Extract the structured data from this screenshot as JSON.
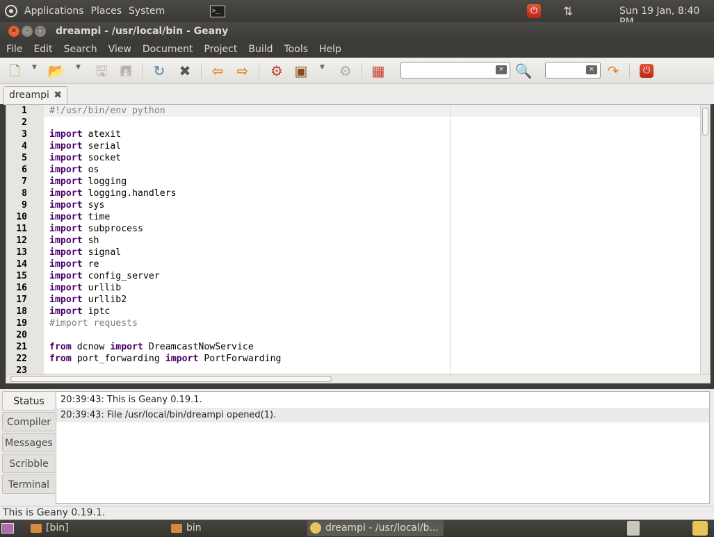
{
  "top_panel": {
    "menus": [
      "Applications",
      "Places",
      "System"
    ],
    "clock": "Sun 19 Jan,  8:40 PM"
  },
  "window": {
    "title": "dreampi - /usr/local/bin - Geany"
  },
  "menu_bar": [
    "File",
    "Edit",
    "Search",
    "View",
    "Document",
    "Project",
    "Build",
    "Tools",
    "Help"
  ],
  "tab": {
    "label": "dreampi"
  },
  "editor": {
    "lines": [
      {
        "n": "1",
        "parts": [
          {
            "t": "#!/usr/bin/env python",
            "c": "cm"
          }
        ]
      },
      {
        "n": "2",
        "parts": []
      },
      {
        "n": "3",
        "parts": [
          {
            "t": "import",
            "c": "kw"
          },
          {
            "t": " atexit",
            "c": ""
          }
        ]
      },
      {
        "n": "4",
        "parts": [
          {
            "t": "import",
            "c": "kw"
          },
          {
            "t": " serial",
            "c": ""
          }
        ]
      },
      {
        "n": "5",
        "parts": [
          {
            "t": "import",
            "c": "kw"
          },
          {
            "t": " socket",
            "c": ""
          }
        ]
      },
      {
        "n": "6",
        "parts": [
          {
            "t": "import",
            "c": "kw"
          },
          {
            "t": " os",
            "c": ""
          }
        ]
      },
      {
        "n": "7",
        "parts": [
          {
            "t": "import",
            "c": "kw"
          },
          {
            "t": " logging",
            "c": ""
          }
        ]
      },
      {
        "n": "8",
        "parts": [
          {
            "t": "import",
            "c": "kw"
          },
          {
            "t": " logging.handlers",
            "c": ""
          }
        ]
      },
      {
        "n": "9",
        "parts": [
          {
            "t": "import",
            "c": "kw"
          },
          {
            "t": " sys",
            "c": ""
          }
        ]
      },
      {
        "n": "10",
        "parts": [
          {
            "t": "import",
            "c": "kw"
          },
          {
            "t": " time",
            "c": ""
          }
        ]
      },
      {
        "n": "11",
        "parts": [
          {
            "t": "import",
            "c": "kw"
          },
          {
            "t": " subprocess",
            "c": ""
          }
        ]
      },
      {
        "n": "12",
        "parts": [
          {
            "t": "import",
            "c": "kw"
          },
          {
            "t": " sh",
            "c": ""
          }
        ]
      },
      {
        "n": "13",
        "parts": [
          {
            "t": "import",
            "c": "kw"
          },
          {
            "t": " signal",
            "c": ""
          }
        ]
      },
      {
        "n": "14",
        "parts": [
          {
            "t": "import",
            "c": "kw"
          },
          {
            "t": " re",
            "c": ""
          }
        ]
      },
      {
        "n": "15",
        "parts": [
          {
            "t": "import",
            "c": "kw"
          },
          {
            "t": " config_server",
            "c": ""
          }
        ]
      },
      {
        "n": "16",
        "parts": [
          {
            "t": "import",
            "c": "kw"
          },
          {
            "t": " urllib",
            "c": ""
          }
        ]
      },
      {
        "n": "17",
        "parts": [
          {
            "t": "import",
            "c": "kw"
          },
          {
            "t": " urllib2",
            "c": ""
          }
        ]
      },
      {
        "n": "18",
        "parts": [
          {
            "t": "import",
            "c": "kw"
          },
          {
            "t": " iptc",
            "c": ""
          }
        ]
      },
      {
        "n": "19",
        "parts": [
          {
            "t": "#import requests",
            "c": "cm"
          }
        ]
      },
      {
        "n": "20",
        "parts": []
      },
      {
        "n": "21",
        "parts": [
          {
            "t": "from",
            "c": "kw"
          },
          {
            "t": " dcnow ",
            "c": ""
          },
          {
            "t": "import",
            "c": "kw"
          },
          {
            "t": " DreamcastNowService",
            "c": ""
          }
        ]
      },
      {
        "n": "22",
        "parts": [
          {
            "t": "from",
            "c": "kw"
          },
          {
            "t": " port_forwarding ",
            "c": ""
          },
          {
            "t": "import",
            "c": "kw"
          },
          {
            "t": " PortForwarding",
            "c": ""
          }
        ]
      },
      {
        "n": "23",
        "parts": []
      }
    ]
  },
  "message_window": {
    "tabs": [
      "Status",
      "Compiler",
      "Messages",
      "Scribble",
      "Terminal"
    ],
    "active_tab": "Status",
    "lines": [
      "20:39:43: This is Geany 0.19.1.",
      "20:39:43: File /usr/local/bin/dreampi opened(1)."
    ]
  },
  "statusbar": {
    "text": "This is Geany 0.19.1."
  },
  "taskbar": {
    "items": [
      {
        "label": "[bin]",
        "icon": "folder-icon",
        "active": false
      },
      {
        "label": "bin",
        "icon": "folder-icon",
        "active": false
      },
      {
        "label": "dreampi - /usr/local/b...",
        "icon": "geany-icon",
        "active": true
      }
    ]
  },
  "colors": {
    "keyword": "#4a0069",
    "comment": "#808080",
    "panel": "#3c3b37"
  }
}
